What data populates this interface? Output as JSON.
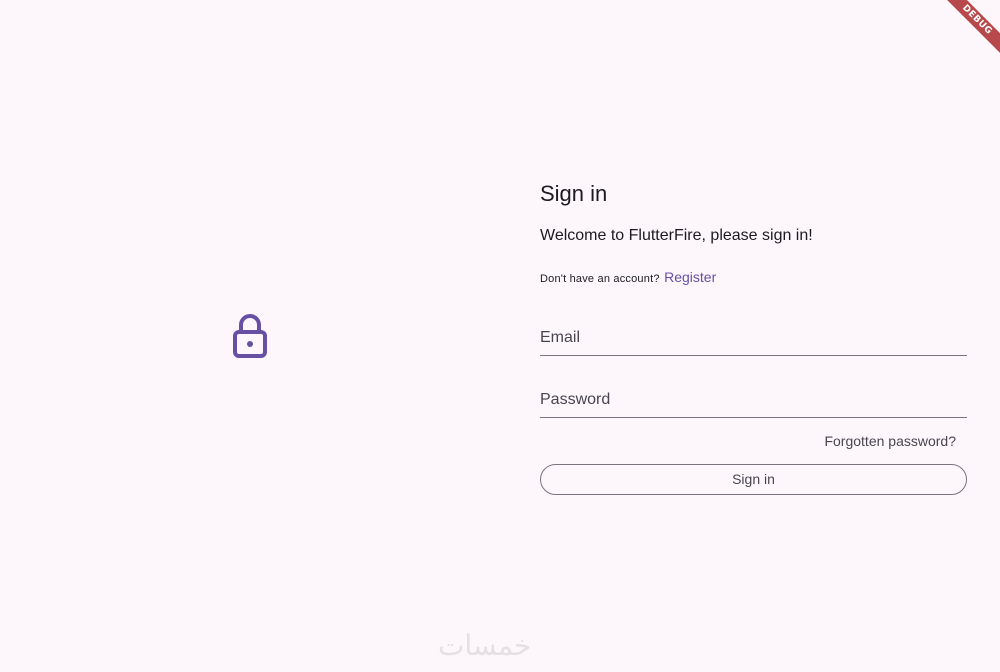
{
  "debug_banner": {
    "label": "DEBUG"
  },
  "left_pane": {
    "icon": "lock-icon",
    "icon_color": "#6750a4"
  },
  "signin_form": {
    "title": "Sign in",
    "welcome": "Welcome to FlutterFire, please sign in!",
    "register_prompt": "Don't have an account?",
    "register_link": "Register",
    "email_label": "Email",
    "email_value": "",
    "password_label": "Password",
    "password_value": "",
    "forgot_password": "Forgotten password?",
    "signin_button": "Sign in"
  },
  "watermark": {
    "text": "خمسات"
  },
  "colors": {
    "background": "#fdf7fc",
    "primary": "#6750a4",
    "outline": "#79747e",
    "debug_ribbon": "#b7484c"
  }
}
